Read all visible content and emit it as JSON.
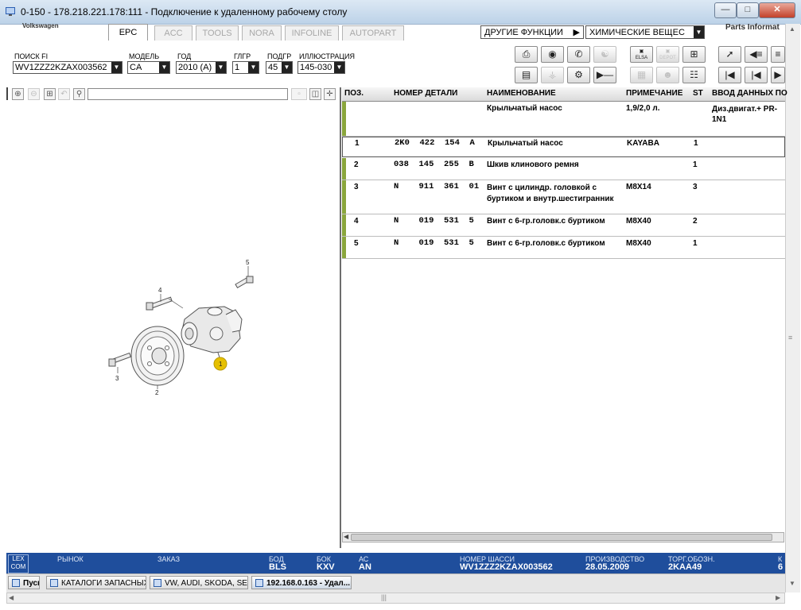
{
  "window": {
    "title": "0-150 - 178.218.221.178:111 - Подключение к удаленному рабочему столу"
  },
  "header": {
    "brand": "Volkswagen",
    "tabs": [
      {
        "label": "EPC",
        "active": true
      },
      {
        "label": "ACC",
        "active": false
      },
      {
        "label": "TOOLS",
        "active": false
      },
      {
        "label": "NORA",
        "active": false
      },
      {
        "label": "INFOLINE",
        "active": false
      },
      {
        "label": "AUTOPART",
        "active": false
      }
    ],
    "other_functions": "ДРУГИЕ ФУНКЦИИ",
    "chemicals": "ХИМИЧЕСКИЕ ВЕЩЕС",
    "parts_info": "Parts Informat"
  },
  "filters": {
    "fi_search": {
      "label": "ПОИСК FI",
      "value": "WV1ZZZ2KZAX003562"
    },
    "model": {
      "label": "МОДЕЛЬ",
      "value": "CA"
    },
    "year": {
      "label": "ГОД",
      "value": "2010 (A)"
    },
    "main_group": {
      "label": "ГЛГР",
      "value": "1"
    },
    "sub_group": {
      "label": "ПОДГР",
      "value": "45"
    },
    "illustration": {
      "label": "ИЛЛЮСТРАЦИЯ",
      "value": "145-030"
    }
  },
  "toolbar": {
    "row1": [
      "print-icon",
      "disc-icon",
      "fax-icon",
      "connect-icon",
      "elsa-icon",
      "depot-icon",
      "cart-add-icon",
      "pin-icon",
      "list-back-icon",
      "list-forward-icon"
    ],
    "row2": [
      "list-icon",
      "key-icon",
      "car-part-icon",
      "play-stop-icon",
      "network-icon",
      "person-icon",
      "cart-icon",
      "first-icon",
      "previous-icon",
      "next-icon"
    ],
    "elsa_label": "ELSA",
    "depot_label": "DEPOT"
  },
  "table": {
    "headers": [
      "ПОЗ.",
      "НОМЕР ДЕТАЛИ",
      "НАИМЕНОВАНИЕ",
      "ПРИМЕЧАНИЕ",
      "ST",
      "ВВОД ДАННЫХ ПО"
    ],
    "title_row": {
      "name": "Крыльчатый насос",
      "note": "1,9/2,0 л.",
      "data": "Диз.двигат.+ PR-1N1"
    },
    "rows": [
      {
        "pos": "1",
        "part": "2K0  422  154  A",
        "name": "Крыльчатый насос",
        "note": "KAYABA",
        "st": "1"
      },
      {
        "pos": "2",
        "part": "038  145  255  B",
        "name": "Шкив клинового ремня",
        "note": "",
        "st": "1"
      },
      {
        "pos": "3",
        "part": "N    911  361  01",
        "name": "Винт с цилиндр. головкой с буртиком и внутр.шестигранник",
        "note": "M8X14",
        "st": "3"
      },
      {
        "pos": "4",
        "part": "N    019  531  5",
        "name": "Винт с 6-гр.головк.с буртиком",
        "note": "M8X40",
        "st": "2"
      },
      {
        "pos": "5",
        "part": "N    019  531  5",
        "name": "Винт с 6-гр.головк.с буртиком",
        "note": "M8X40",
        "st": "1"
      }
    ]
  },
  "diagram": {
    "callouts": [
      "1",
      "2",
      "3",
      "4",
      "5"
    ],
    "highlight": "#e6c000"
  },
  "status": {
    "logo": "LEX COM",
    "market_label": "РЫНОК",
    "order_label": "ЗАКАЗ",
    "bod_label": "БОД",
    "bod": "BLS",
    "bok_label": "БОК",
    "bok": "KXV",
    "ac_label": "АС",
    "ac": "AN",
    "chassis_label": "НОМЕР ШАССИ",
    "chassis": "WV1ZZZ2KZAX003562",
    "production_label": "ПРОИЗВОДСТВО",
    "production": "28.05.2009",
    "trade_label": "ТОРГ.ОБОЗН.",
    "trade": "2KAA49",
    "k_label": "К",
    "k": "6"
  },
  "taskbar": {
    "start": "Пуск",
    "items": [
      "КАТАЛОГИ ЗАПАСНЫХ ...",
      "VW, AUDI, SKODA, SEAT",
      "192.168.0.163 - Удал..."
    ]
  },
  "colors": {
    "status_bg": "#1f4e9c",
    "row_marker": "#8aa63c",
    "callout_highlight": "#e6c000"
  }
}
